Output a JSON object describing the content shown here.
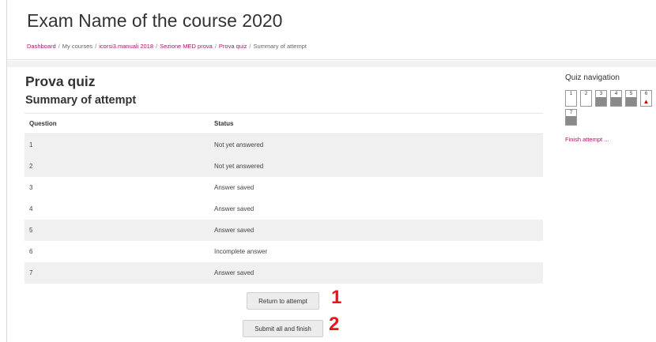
{
  "header": {
    "course_title": "Exam Name of the course 2020",
    "breadcrumb": [
      {
        "label": "Dashboard",
        "link": true
      },
      {
        "label": "My courses",
        "link": false
      },
      {
        "label": "icorsi3.manuali 2018",
        "link": true
      },
      {
        "label": "Sezione MED prova",
        "link": true
      },
      {
        "label": "Prova quiz",
        "link": true
      },
      {
        "label": "Summary of attempt",
        "link": false
      }
    ]
  },
  "main": {
    "quiz_title": "Prova quiz",
    "summary_title": "Summary of attempt",
    "table": {
      "headers": [
        "Question",
        "Status"
      ],
      "rows": [
        {
          "question": "1",
          "status": "Not yet answered"
        },
        {
          "question": "2",
          "status": "Not yet answered"
        },
        {
          "question": "3",
          "status": "Answer saved"
        },
        {
          "question": "4",
          "status": "Answer saved"
        },
        {
          "question": "5",
          "status": "Answer saved"
        },
        {
          "question": "6",
          "status": "Incomplete answer"
        },
        {
          "question": "7",
          "status": "Answer saved"
        }
      ]
    },
    "return_button": "Return to attempt",
    "submit_button": "Submit all and finish"
  },
  "annotations": {
    "one": "1",
    "two": "2",
    "color": "#e8141b"
  },
  "sidebar": {
    "title": "Quiz navigation",
    "questions": [
      {
        "label": "1",
        "state": "empty"
      },
      {
        "label": "2",
        "state": "empty"
      },
      {
        "label": "3",
        "state": "answered"
      },
      {
        "label": "4",
        "state": "answered"
      },
      {
        "label": "5",
        "state": "answered"
      },
      {
        "label": "6",
        "state": "flagged"
      },
      {
        "label": "7",
        "state": "answered"
      }
    ],
    "finish_link": "Finish attempt ..."
  },
  "colors": {
    "link": "#a3186d",
    "answered_fill": "#8a8a8a",
    "row_stripe": "#f0f0f0"
  }
}
